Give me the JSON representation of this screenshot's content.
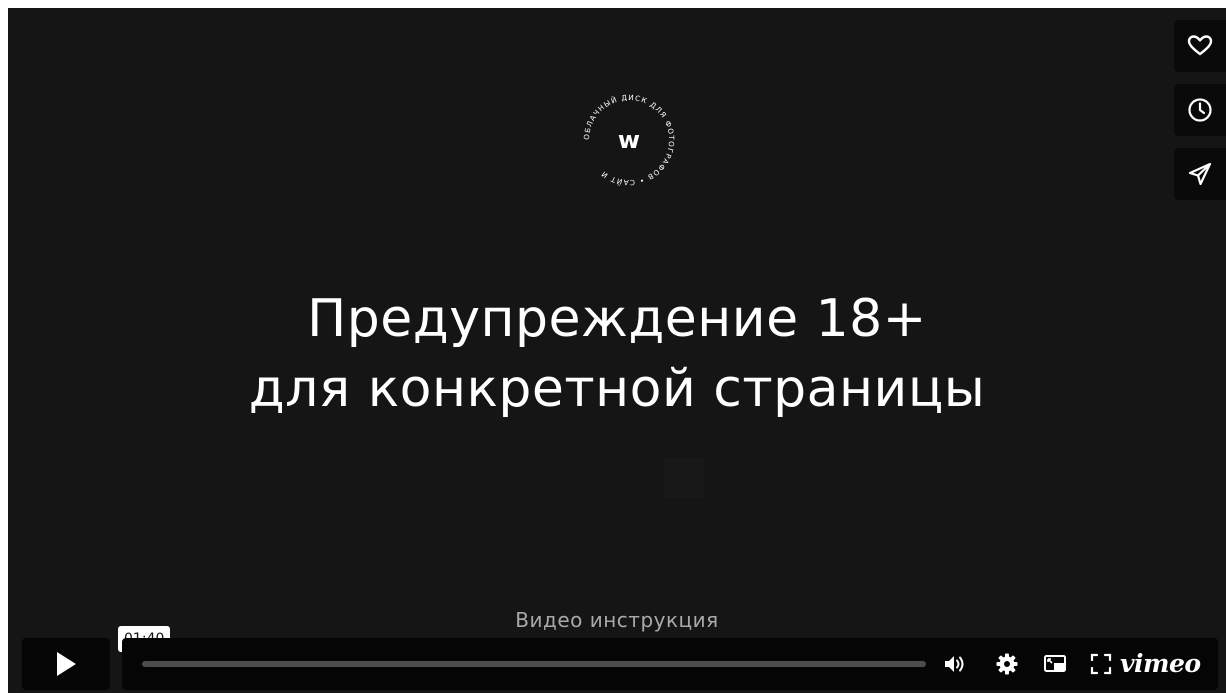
{
  "video": {
    "title_line1": "Предупреждение 18+",
    "title_line2": "для конкретной страницы",
    "caption": "Видео инструкция",
    "logo_letter": "w",
    "logo_ring_text": "ОБЛАЧНЫЙ ДИСК ДЛЯ ФОТОГРАФОВ • САЙТ И "
  },
  "side_buttons": [
    {
      "icon": "heart-icon"
    },
    {
      "icon": "clock-icon"
    },
    {
      "icon": "send-icon"
    }
  ],
  "controls": {
    "time_tooltip": "01:40",
    "progress_fraction": 0,
    "brand": "vimeo",
    "icons": [
      "play-icon",
      "volume-icon",
      "settings-icon",
      "pip-icon",
      "fullscreen-icon"
    ]
  },
  "colors": {
    "background": "#151515",
    "button_bg": "#0a0a0a",
    "text": "#ffffff",
    "caption": "#a9a9a9"
  }
}
